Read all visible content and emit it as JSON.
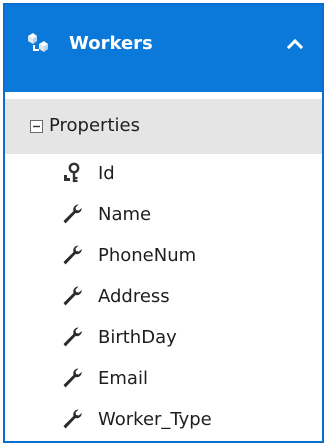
{
  "entity": {
    "title": "Workers",
    "icon": "entity-icon",
    "collapse_icon": "chevron-up-icon"
  },
  "section": {
    "label": "Properties",
    "toggle_icon": "collapse-minus-icon"
  },
  "properties": [
    {
      "name": "Id",
      "icon": "key-icon"
    },
    {
      "name": "Name",
      "icon": "wrench-icon"
    },
    {
      "name": "PhoneNum",
      "icon": "wrench-icon"
    },
    {
      "name": "Address",
      "icon": "wrench-icon"
    },
    {
      "name": "BirthDay",
      "icon": "wrench-icon"
    },
    {
      "name": "Email",
      "icon": "wrench-icon"
    },
    {
      "name": "Worker_Type",
      "icon": "wrench-icon"
    }
  ],
  "colors": {
    "header": "#0b79d9",
    "border": "#0a6ed1",
    "section": "#e5e5e5"
  }
}
